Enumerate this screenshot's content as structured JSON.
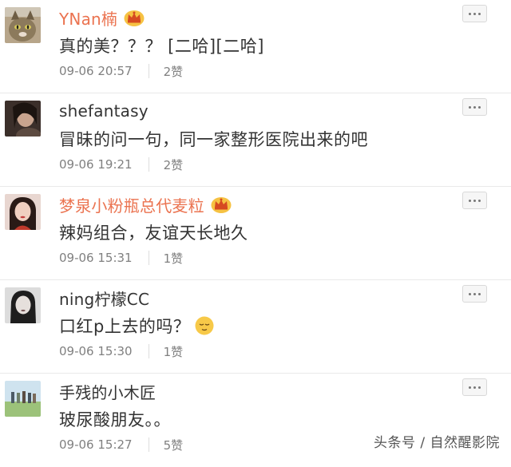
{
  "comments": [
    {
      "user": "YNan楠",
      "vip": true,
      "text": "真的美？？？ [二哈][二哈]",
      "time": "09-06 20:57",
      "likes": "2赞",
      "avatar_icon": "cat-avatar-icon"
    },
    {
      "user": "shefantasy",
      "vip": false,
      "text": "冒昧的问一句，同一家整形医院出来的吧",
      "time": "09-06 19:21",
      "likes": "2赞",
      "avatar_icon": "woman-portrait-avatar-icon"
    },
    {
      "user": "梦泉小粉瓶总代麦粒",
      "vip": true,
      "text": "辣妈组合，友谊天长地久",
      "time": "09-06 15:31",
      "likes": "1赞",
      "avatar_icon": "woman-red-avatar-icon"
    },
    {
      "user": "ning柠檬CC",
      "vip": false,
      "text": "口红p上去的吗？",
      "time": "09-06 15:30",
      "likes": "1赞",
      "avatar_icon": "woman-bw-avatar-icon",
      "emoji": "relieved-face-icon"
    },
    {
      "user": "手残的小木匠",
      "vip": false,
      "text": "玻尿酸朋友。。",
      "time": "09-06 15:27",
      "likes": "5赞",
      "avatar_icon": "landscape-people-avatar-icon"
    }
  ],
  "more_icon": "more-dots-icon",
  "vip_icon": "crown-icon",
  "watermark": "头条号 / 自然醒影院",
  "colors": {
    "vip_name": "#eb7350",
    "name": "#333333",
    "meta": "#808080",
    "divider": "#e9e9e9"
  }
}
